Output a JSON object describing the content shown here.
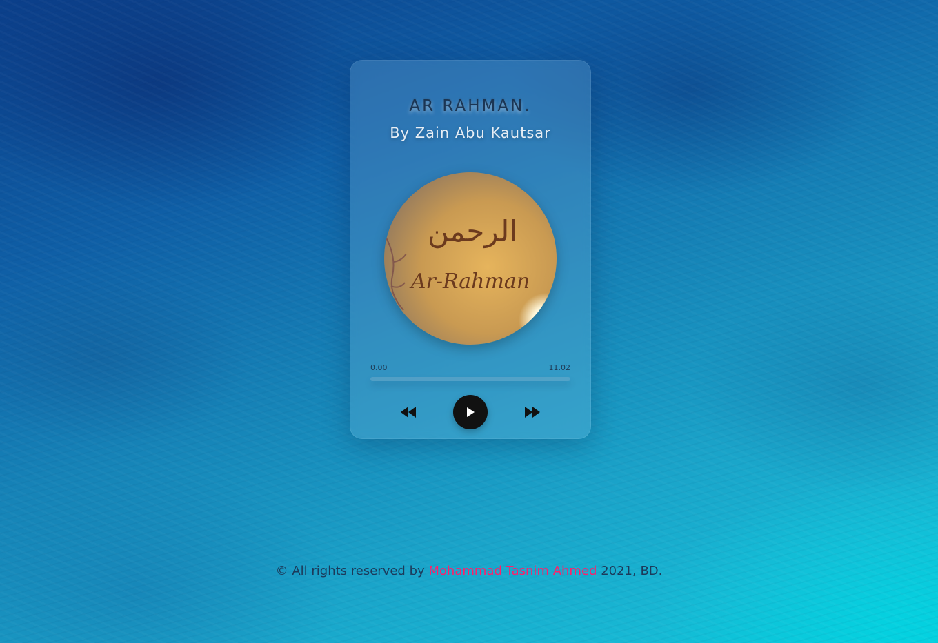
{
  "player": {
    "title": "AR RAHMAN.",
    "artist": "By Zain Abu Kautsar",
    "artwork": {
      "arabic_text": "الرحمن",
      "latin_text": "Ar-Rahman"
    },
    "time_current": "0.00",
    "time_total": "11.02",
    "progress_fraction": 0,
    "controls": {
      "prev_icon": "rewind-icon",
      "play_icon": "play-icon",
      "next_icon": "fast-forward-icon"
    }
  },
  "footer": {
    "prefix": "© All rights reserved by",
    "author": "Mohammad Tasnim Ahmed",
    "suffix": "2021, BD."
  },
  "colors": {
    "accent_link": "#ff1f6a",
    "play_button": "#111111"
  }
}
